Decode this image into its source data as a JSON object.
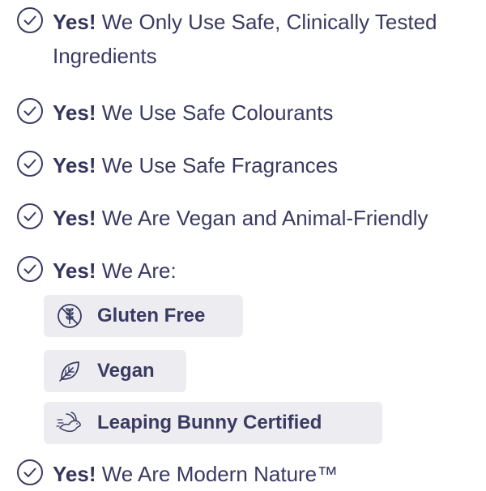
{
  "items": [
    {
      "bold": "Yes!",
      "text": " We Only Use Safe, Clinically Tested Ingredients"
    },
    {
      "bold": "Yes!",
      "text": " We Use Safe Colourants"
    },
    {
      "bold": "Yes!",
      "text": " We Use Safe Fragrances"
    },
    {
      "bold": "Yes!",
      "text": " We Are Vegan and Animal-Friendly"
    },
    {
      "bold": "Yes!",
      "text": " We Are:"
    },
    {
      "bold": "Yes!",
      "text": " We Are Modern Nature™"
    }
  ],
  "badges": [
    {
      "label": "Gluten Free",
      "icon": "gluten-free-icon"
    },
    {
      "label": "Vegan",
      "icon": "leaf-icon"
    },
    {
      "label": "Leaping Bunny Certified",
      "icon": "bunny-icon"
    }
  ],
  "colors": {
    "text": "#3a3a63",
    "badge_bg": "#ededf1"
  }
}
